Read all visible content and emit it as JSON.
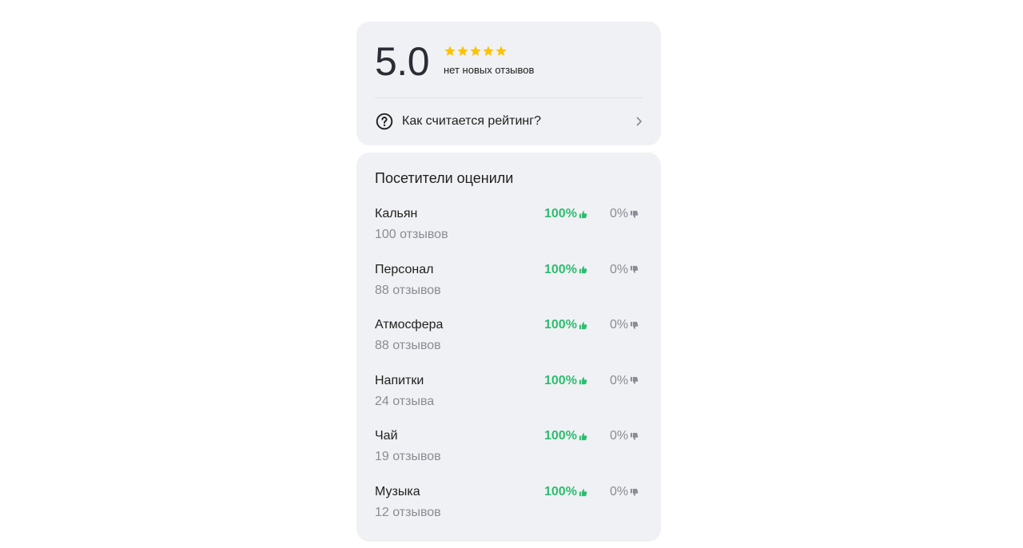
{
  "rating": {
    "score": "5.0",
    "stars_filled": 5,
    "stars_total": 5,
    "subtitle": "нет новых отзывов",
    "how_calculated": "Как считается рейтинг?"
  },
  "aspects": {
    "title": "Посетители оценили",
    "items": [
      {
        "name": "Кальян",
        "count": "100 отзывов",
        "positive": "100%",
        "negative": "0%"
      },
      {
        "name": "Персонал",
        "count": "88 отзывов",
        "positive": "100%",
        "negative": "0%"
      },
      {
        "name": "Атмосфера",
        "count": "88 отзывов",
        "positive": "100%",
        "negative": "0%"
      },
      {
        "name": "Напитки",
        "count": "24 отзыва",
        "positive": "100%",
        "negative": "0%"
      },
      {
        "name": "Чай",
        "count": "19 отзывов",
        "positive": "100%",
        "negative": "0%"
      },
      {
        "name": "Музыка",
        "count": "12 отзывов",
        "positive": "100%",
        "negative": "0%"
      }
    ]
  },
  "colors": {
    "star": "#fcc203",
    "positive": "#2dbd70",
    "negative": "#8a8c94",
    "card_bg": "#f0f1f4"
  },
  "icons": {
    "help": "question-circle-icon",
    "chevron": "chevron-right-icon",
    "positive": "thumb-up-icon",
    "negative": "thumb-down-icon"
  }
}
